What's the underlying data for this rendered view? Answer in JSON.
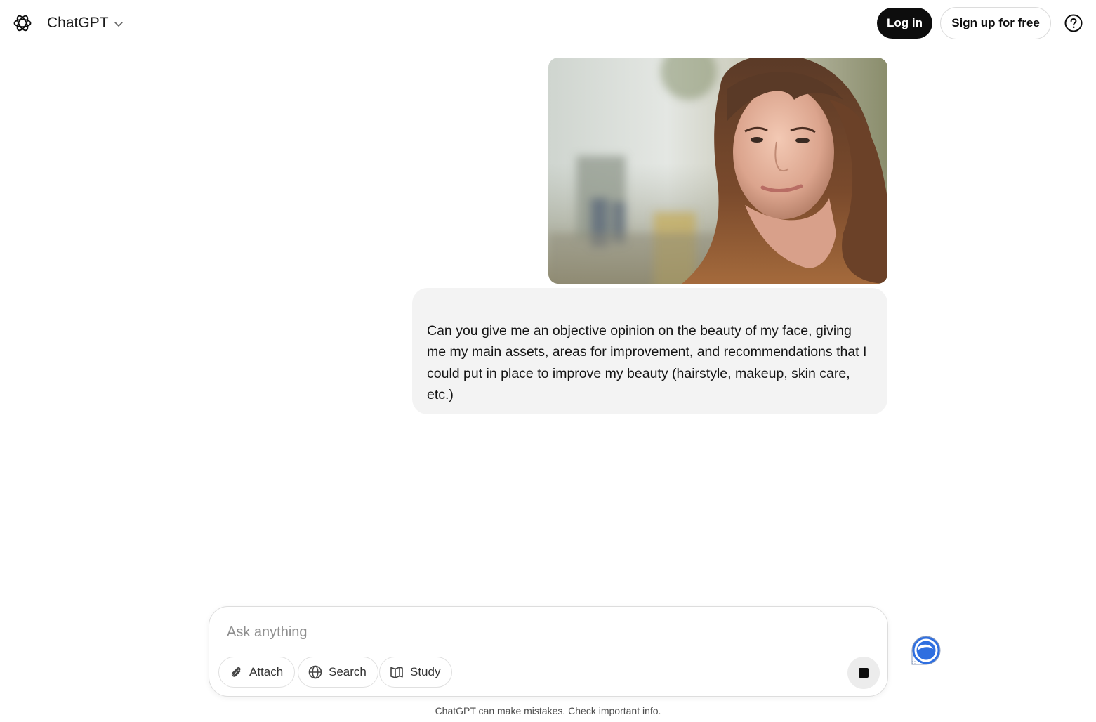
{
  "header": {
    "model_name": "ChatGPT",
    "login_label": "Log in",
    "signup_label": "Sign up for free",
    "icons": {
      "logo": "openai-logo-icon",
      "model_menu": "chevron-down-icon",
      "help": "question-circle-icon"
    }
  },
  "conversation": {
    "user_message": {
      "image_alt": "Uploaded photo of a smiling woman with long auburn hair",
      "text": "Can you give me an objective opinion on the beauty of my face, giving me my main assets, areas for improvement, and recommendations that I could put in place to improve my beauty (hairstyle, makeup, skin care, etc.)"
    }
  },
  "composer": {
    "placeholder": "Ask anything",
    "value": "",
    "buttons": [
      {
        "label": "Attach",
        "icon": "paperclip-icon"
      },
      {
        "label": "Search",
        "icon": "globe-icon"
      },
      {
        "label": "Study",
        "icon": "book-icon"
      }
    ],
    "stop_icon": "stop-square-icon"
  },
  "extension_badge_icon": "extension-badge-icon",
  "footer": {
    "disclaimer": "ChatGPT can make mistakes. Check important info."
  },
  "colors": {
    "primary_button": "#0d0d0d",
    "bubble_bg": "#f3f3f3",
    "badge_blue": "#2f6fe0"
  }
}
